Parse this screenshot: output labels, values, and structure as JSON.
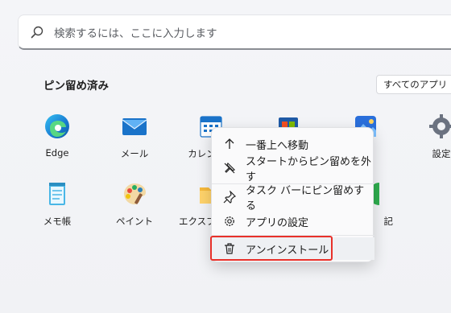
{
  "search": {
    "placeholder": "検索するには、ここに入力します"
  },
  "pinned": {
    "title": "ピン留め済み",
    "all_apps_label": "すべてのアプリ",
    "all_apps_chevron": "›"
  },
  "apps": [
    {
      "label": "Edge",
      "icon": "edge-icon"
    },
    {
      "label": "メール",
      "icon": "mail-icon"
    },
    {
      "label": "カレンダー",
      "icon": "calendar-icon"
    },
    {
      "label": "",
      "icon": "store-icon"
    },
    {
      "label": "ト",
      "icon": "photos-icon"
    },
    {
      "label": "設定",
      "icon": "settings-icon"
    },
    {
      "label": "メモ帳",
      "icon": "notepad-icon"
    },
    {
      "label": "ペイント",
      "icon": "paint-icon"
    },
    {
      "label": "エクスプローラー",
      "icon": "explorer-icon"
    },
    {
      "label": "記",
      "icon": "green-app-icon"
    }
  ],
  "context_menu": {
    "items": [
      {
        "label": "一番上へ移動",
        "icon": "arrow-up-icon"
      },
      {
        "label": "スタートからピン留めを外す",
        "icon": "unpin-icon"
      },
      {
        "label": "タスク バーにピン留めする",
        "icon": "pin-icon"
      },
      {
        "label": "アプリの設定",
        "icon": "gear-icon"
      },
      {
        "label": "アンインストール",
        "icon": "trash-icon"
      }
    ]
  },
  "colors": {
    "highlight_border": "#e8312a",
    "accent": "#0067c0"
  }
}
